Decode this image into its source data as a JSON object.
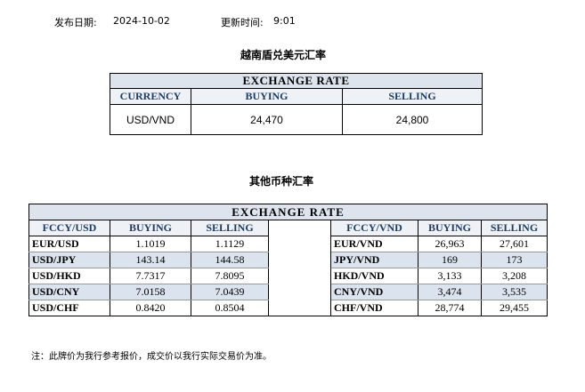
{
  "header": {
    "date_label": "发布日期:",
    "date_value": "2024-10-02",
    "time_label": "更新时间:",
    "time_value": "9:01"
  },
  "vnd_section": {
    "title": "越南盾兑美元汇率",
    "band": "EXCHANGE RATE",
    "columns": [
      "CURRENCY",
      "BUYING",
      "SELLING"
    ],
    "row": {
      "currency": "USD/VND",
      "buying": "24,470",
      "selling": "24,800"
    }
  },
  "other_section": {
    "title": "其他币种汇率",
    "band": "EXCHANGE  RATE",
    "columns": [
      "FCCY/USD",
      "BUYING",
      "SELLING",
      "",
      "FCCY/VND",
      "BUYING",
      "SELLING"
    ],
    "rows": [
      {
        "usd_pair": "EUR/USD",
        "usd_buy": "1.1019",
        "usd_sell": "1.1129",
        "vnd_pair": "EUR/VND",
        "vnd_buy": "26,963",
        "vnd_sell": "27,601"
      },
      {
        "usd_pair": "USD/JPY",
        "usd_buy": "143.14",
        "usd_sell": "144.58",
        "vnd_pair": "JPY/VND",
        "vnd_buy": "169",
        "vnd_sell": "173"
      },
      {
        "usd_pair": "USD/HKD",
        "usd_buy": "7.7317",
        "usd_sell": "7.8095",
        "vnd_pair": "HKD/VND",
        "vnd_buy": "3,133",
        "vnd_sell": "3,208"
      },
      {
        "usd_pair": "USD/CNY",
        "usd_buy": "7.0158",
        "usd_sell": "7.0439",
        "vnd_pair": "CNY/VND",
        "vnd_buy": "3,474",
        "vnd_sell": "3,535"
      },
      {
        "usd_pair": "USD/CHF",
        "usd_buy": "0.8420",
        "usd_sell": "0.8504",
        "vnd_pair": "CHF/VND",
        "vnd_buy": "28,774",
        "vnd_sell": "29,455"
      }
    ]
  },
  "footnote": "注：此牌价为我行参考报价，成交价以我行实际交易价为准。"
}
